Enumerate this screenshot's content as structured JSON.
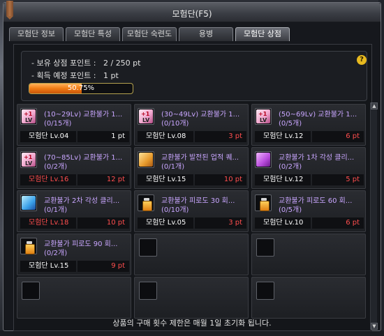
{
  "window": {
    "title": "모험단(F5)"
  },
  "tabs": [
    {
      "label": "모험단 정보"
    },
    {
      "label": "모험단 특성"
    },
    {
      "label": "모험단 숙련도"
    },
    {
      "label": "용병"
    },
    {
      "label": "모험단 상점"
    }
  ],
  "active_tab": "모험단 상점",
  "points": {
    "owned_line": "- 보유 상점 포인트 :   2 / 250 pt",
    "expected_line": "- 획득 예정 포인트 :   1 pt",
    "progress_label": "50.75%",
    "progress_value": 0.5075
  },
  "items": [
    {
      "name": "(10~29Lv) 교환불가 1...",
      "count": "(0/15개)",
      "level": "모험단 Lv.04",
      "level_red": false,
      "price": "1 pt",
      "price_red": false,
      "icon": "level-up-box-icon"
    },
    {
      "name": "(30~49Lv) 교환불가 1...",
      "count": "(0/10개)",
      "level": "모험단 Lv.08",
      "level_red": false,
      "price": "3 pt",
      "price_red": true,
      "icon": "level-up-box-icon"
    },
    {
      "name": "(50~69Lv) 교환불가 1...",
      "count": "(0/5개)",
      "level": "모험단 Lv.12",
      "level_red": false,
      "price": "6 pt",
      "price_red": true,
      "icon": "level-up-box-icon"
    },
    {
      "name": "(70~85Lv) 교환불가 1...",
      "count": "(0/2개)",
      "level": "모험단 Lv.16",
      "level_red": true,
      "price": "12 pt",
      "price_red": true,
      "icon": "level-up-box-icon"
    },
    {
      "name": "교환불가 발전된 업적 퀘...",
      "count": "(0/1개)",
      "level": "모험단 Lv.15",
      "level_red": false,
      "price": "10 pt",
      "price_red": true,
      "icon": "clear-ticket-gold-icon"
    },
    {
      "name": "교환불가 1차 각성 클리...",
      "count": "(0/2개)",
      "level": "모험단 Lv.12",
      "level_red": false,
      "price": "5 pt",
      "price_red": true,
      "icon": "clear-ticket-purple-icon"
    },
    {
      "name": "교환불가 2차 각성 클리...",
      "count": "(0/1개)",
      "level": "모험단 Lv.18",
      "level_red": true,
      "price": "10 pt",
      "price_red": true,
      "icon": "clear-ticket-blue-icon"
    },
    {
      "name": "교환불가 피로도 30 회...",
      "count": "(0/10개)",
      "level": "모험단 Lv.05",
      "level_red": false,
      "price": "3 pt",
      "price_red": true,
      "icon": "potion-icon"
    },
    {
      "name": "교환불가 피로도 60 회...",
      "count": "(0/5개)",
      "level": "모험단 Lv.10",
      "level_red": false,
      "price": "6 pt",
      "price_red": true,
      "icon": "potion-icon"
    },
    {
      "name": "교환불가 피로도 90 회...",
      "count": "(0/2개)",
      "level": "모험단 Lv.15",
      "level_red": false,
      "price": "9 pt",
      "price_red": true,
      "icon": "potion-icon"
    }
  ],
  "empty_slots": 5,
  "footer": {
    "note": "상품의 구매 횟수 제한은 매월 1일 초기화 됩니다."
  },
  "colors": {
    "item_name": "#c9a6ff",
    "warning_red": "#ff4e4e",
    "progress": "#f07b14",
    "help": "#e7b91f"
  }
}
